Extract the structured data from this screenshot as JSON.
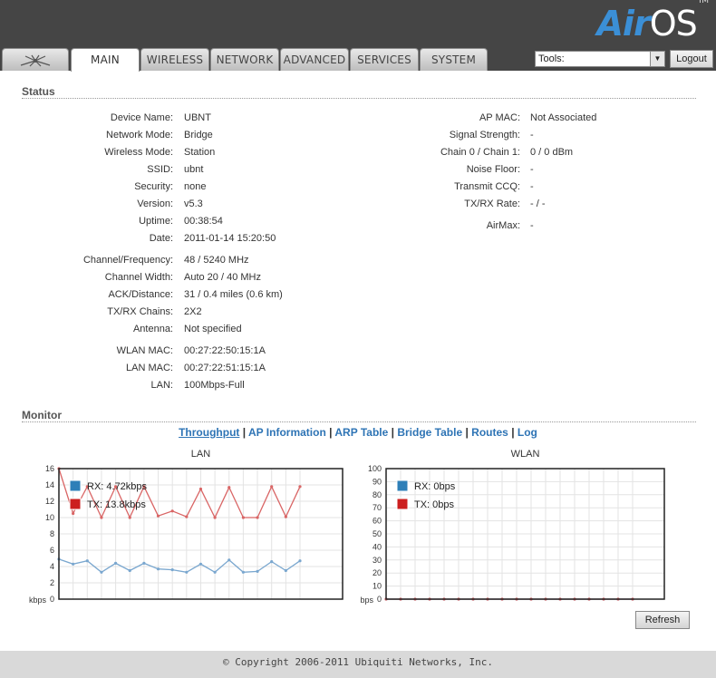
{
  "header": {
    "logo": {
      "air": "Air",
      "os": "OS",
      "tm": "TM"
    },
    "tabs": [
      {
        "label": "",
        "icon": "ubiquiti-logo-icon"
      },
      {
        "label": "MAIN",
        "active": true
      },
      {
        "label": "WIRELESS"
      },
      {
        "label": "NETWORK"
      },
      {
        "label": "ADVANCED"
      },
      {
        "label": "SERVICES"
      },
      {
        "label": "SYSTEM"
      }
    ],
    "tools": {
      "selected": "Tools:"
    },
    "logout_label": "Logout"
  },
  "status": {
    "title": "Status",
    "left": [
      {
        "label": "Device Name:",
        "value": "UBNT"
      },
      {
        "label": "Network Mode:",
        "value": "Bridge"
      },
      {
        "label": "Wireless Mode:",
        "value": "Station"
      },
      {
        "label": "SSID:",
        "value": "ubnt"
      },
      {
        "label": "Security:",
        "value": "none"
      },
      {
        "label": "Version:",
        "value": "v5.3"
      },
      {
        "label": "Uptime:",
        "value": "00:38:54"
      },
      {
        "label": "Date:",
        "value": "2011-01-14 15:20:50"
      },
      {
        "label": "Channel/Frequency:",
        "value": "48 / 5240 MHz"
      },
      {
        "label": "Channel Width:",
        "value": "Auto 20 / 40 MHz"
      },
      {
        "label": "ACK/Distance:",
        "value": "31 / 0.4 miles (0.6 km)"
      },
      {
        "label": "TX/RX Chains:",
        "value": "2X2"
      },
      {
        "label": "Antenna:",
        "value": "Not specified"
      },
      {
        "label": "WLAN MAC:",
        "value": "00:27:22:50:15:1A"
      },
      {
        "label": "LAN MAC:",
        "value": "00:27:22:51:15:1A"
      },
      {
        "label": "LAN:",
        "value": "100Mbps-Full"
      }
    ],
    "right": [
      {
        "label": "AP MAC:",
        "value": "Not Associated"
      },
      {
        "label": "Signal Strength:",
        "value": "-"
      },
      {
        "label": "Chain 0 / Chain 1:",
        "value": "0 / 0 dBm"
      },
      {
        "label": "Noise Floor:",
        "value": "-"
      },
      {
        "label": "Transmit CCQ:",
        "value": "-"
      },
      {
        "label": "TX/RX Rate:",
        "value": "- / -"
      },
      {
        "label": "AirMax:",
        "value": "-"
      }
    ]
  },
  "monitor": {
    "title": "Monitor",
    "links": [
      {
        "label": "Throughput",
        "selected": true
      },
      {
        "label": "AP Information"
      },
      {
        "label": "ARP Table"
      },
      {
        "label": "Bridge Table"
      },
      {
        "label": "Routes"
      },
      {
        "label": "Log"
      }
    ],
    "separator": "|",
    "refresh_label": "Refresh"
  },
  "colors": {
    "rx": "#2e7fb8",
    "tx": "#cc1e1e",
    "rx_line": "#7aa7cf",
    "tx_line": "#d96565"
  },
  "chart_data": [
    {
      "type": "line",
      "title": "LAN",
      "unit_label": "kbps",
      "ylim": [
        0,
        16
      ],
      "yticks": [
        0,
        2,
        4,
        6,
        8,
        10,
        12,
        14,
        16
      ],
      "grid": true,
      "legend": "top-left",
      "series": [
        {
          "name": "RX: 4.72kbps",
          "key": "rx",
          "values": [
            4.9,
            4.3,
            4.7,
            3.3,
            4.4,
            3.5,
            4.4,
            3.7,
            3.6,
            3.3,
            4.3,
            3.3,
            4.8,
            3.3,
            3.4,
            4.6,
            3.5,
            4.7
          ]
        },
        {
          "name": "TX: 13.8kbps",
          "key": "tx",
          "values": [
            16.0,
            10.5,
            13.8,
            10.0,
            13.8,
            10.0,
            13.8,
            10.2,
            10.8,
            10.1,
            13.5,
            10.0,
            13.7,
            10.0,
            10.0,
            13.8,
            10.1,
            13.8
          ]
        }
      ]
    },
    {
      "type": "line",
      "title": "WLAN",
      "unit_label": "bps",
      "ylim": [
        0,
        100
      ],
      "yticks": [
        0,
        10,
        20,
        30,
        40,
        50,
        60,
        70,
        80,
        90,
        100
      ],
      "grid": true,
      "legend": "top-left",
      "series": [
        {
          "name": "RX: 0bps",
          "key": "rx",
          "values": [
            0,
            0,
            0,
            0,
            0,
            0,
            0,
            0,
            0,
            0,
            0,
            0,
            0,
            0,
            0,
            0,
            0,
            0
          ]
        },
        {
          "name": "TX: 0bps",
          "key": "tx",
          "values": [
            0,
            0,
            0,
            0,
            0,
            0,
            0,
            0,
            0,
            0,
            0,
            0,
            0,
            0,
            0,
            0,
            0,
            0
          ]
        }
      ]
    }
  ],
  "footer": {
    "copyright": "© Copyright 2006-2011 Ubiquiti Networks, Inc."
  }
}
